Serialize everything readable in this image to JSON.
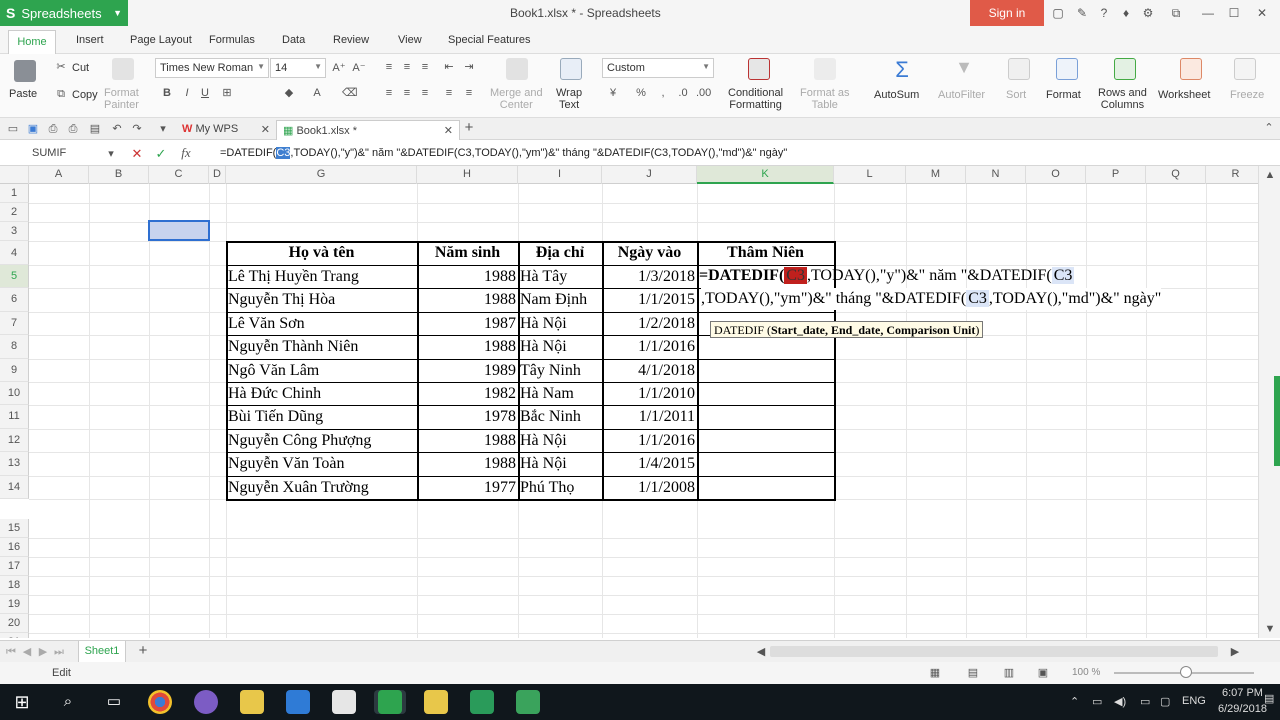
{
  "app": {
    "name": "Spreadsheets",
    "doc_title": "Book1.xlsx * - Spreadsheets",
    "signin": "Sign in"
  },
  "menu_tabs": [
    "Home",
    "Insert",
    "Page Layout",
    "Formulas",
    "Data",
    "Review",
    "View",
    "Special Features"
  ],
  "ribbon": {
    "paste": "Paste",
    "cut": "Cut",
    "copy": "Copy",
    "format_painter_1": "Format",
    "format_painter_2": "Painter",
    "font_name": "Times New Roman",
    "font_size": "14",
    "merge_1": "Merge and",
    "merge_2": "Center",
    "wrap_1": "Wrap",
    "wrap_2": "Text",
    "number_format": "Custom",
    "cond_1": "Conditional",
    "cond_2": "Formatting",
    "fmt_table_1": "Format as",
    "fmt_table_2": "Table",
    "autosum": "AutoSum",
    "autofilter": "AutoFilter",
    "sort": "Sort",
    "format": "Format",
    "rows_cols_1": "Rows and",
    "rows_cols_2": "Columns",
    "worksheet": "Worksheet",
    "freeze": "Freeze"
  },
  "doc_tabs": {
    "mywps": "My WPS",
    "book1": "Book1.xlsx *"
  },
  "formula_bar": {
    "name_box": "SUMIF",
    "fx": "fx",
    "formula_before": "=DATEDIF(",
    "formula_ref": "C3",
    "formula_after": ",TODAY(),\"y\")&\" năm \"&DATEDIF(C3,TODAY(),\"ym\")&\" tháng \"&DATEDIF(C3,TODAY(),\"md\")&\" ngày\""
  },
  "columns": [
    "A",
    "B",
    "C",
    "D",
    "G",
    "H",
    "I",
    "J",
    "K",
    "L",
    "M",
    "N",
    "O",
    "P",
    "Q",
    "R"
  ],
  "rows": [
    "1",
    "2",
    "3",
    "4",
    "5",
    "6",
    "7",
    "8",
    "9",
    "10",
    "11",
    "12",
    "13",
    "14",
    "15",
    "16",
    "17",
    "18",
    "19",
    "20",
    "21"
  ],
  "table": {
    "headers": [
      "Họ và tên",
      "Năm sinh",
      "Địa chỉ",
      "Ngày vào",
      "Thâm Niên"
    ],
    "records": [
      [
        "Lê Thị Huyền Trang",
        "1988",
        "Hà Tây",
        "1/3/2018"
      ],
      [
        "Nguyễn Thị Hòa",
        "1988",
        "Nam Định",
        "1/1/2015"
      ],
      [
        "Lê Văn Sơn",
        "1987",
        "Hà Nội",
        "1/2/2018"
      ],
      [
        "Nguyễn Thành Niên",
        "1988",
        "Hà Nội",
        "1/1/2016"
      ],
      [
        "Ngô Văn Lâm",
        "1989",
        "Tây Ninh",
        "4/1/2018"
      ],
      [
        "Hà Đức Chinh",
        "1982",
        "Hà Nam",
        "1/1/2010"
      ],
      [
        "Bùi Tiến Dũng",
        "1978",
        "Bắc Ninh",
        "1/1/2011"
      ],
      [
        "Nguyễn Công Phượng",
        "1988",
        "Hà Nội",
        "1/1/2016"
      ],
      [
        "Nguyễn Văn Toàn",
        "1988",
        "Hà Nội",
        "1/4/2015"
      ],
      [
        "Nguyễn Xuân Trường",
        "1977",
        "Phú Thọ",
        "1/1/2008"
      ]
    ]
  },
  "in_cell_edit": {
    "l1_a": "=DATEDIF(",
    "l1_ref": "C3",
    "l1_b": ",TODAY(),\"y\")&\" năm \"&DATEDIF(",
    "l1_ref2": "C3",
    "l2_a": ",TODAY(),\"ym\")&\" tháng \"&DATEDIF(",
    "l2_ref": "C3",
    "l2_b": ",TODAY(),\"md\")&\" ngày\""
  },
  "tooltip": {
    "fn": "DATEDIF (",
    "args": "Start_date, End_date, Comparison Unit",
    "close": ")"
  },
  "sheet_tab": "Sheet1",
  "status": {
    "mode": "Edit",
    "zoom": "100 %"
  },
  "tray": {
    "lang": "ENG",
    "time": "6:07 PM",
    "date": "6/29/2018"
  },
  "colors": {
    "accent": "#2ea44f",
    "signin": "#e05a48",
    "ref_active": "#c0201d",
    "ref_hl": "#dbe5f7"
  }
}
